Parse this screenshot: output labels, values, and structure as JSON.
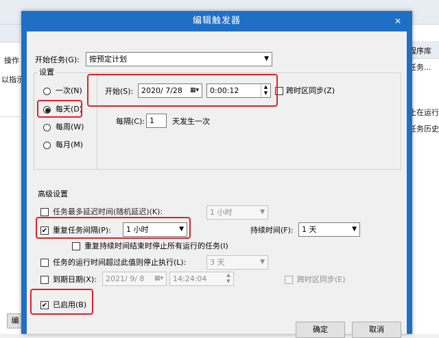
{
  "background": {
    "right_header": "程序库",
    "right_items": [
      "任务...",
      "止在运行",
      "任务历史"
    ],
    "left_items": [
      "操作",
      "以指示"
    ],
    "bottom_left_button": "编"
  },
  "dialog": {
    "title": "编辑触发器",
    "close_label": "✕",
    "begin_task_label": "开始任务(G):",
    "begin_task_value": "按预定计划",
    "settings_label": "设置",
    "schedule_options": [
      "一次(N)",
      "每天(D)",
      "每周(W)",
      "每月(M)"
    ],
    "selected_schedule": 1,
    "start_label": "开始(S):",
    "start_date": "2020/ 7/28",
    "start_time": "0:00:12",
    "sync_timezone_label": "跨时区同步(Z)",
    "recur_label": "每隔(C):",
    "recur_value": "1",
    "recur_unit": "天发生一次",
    "advanced_label": "高级设置",
    "delay_label": "任务最多延迟时间(随机延迟)(K):",
    "delay_value": "1 小时",
    "repeat_label": "重复任务间隔(P):",
    "repeat_value": "1 小时",
    "duration_label": "持续时间(F):",
    "duration_value": "1 天",
    "stop_at_end_label": "重复持续时间结束时停止所有运行的任务(I)",
    "stop_if_longer_label": "任务的运行时间超过此值则停止执行(L):",
    "stop_if_longer_value": "3 天",
    "expire_label": "到期日期(X):",
    "expire_date": "2021/ 9/ 8",
    "expire_time": "14:24:04",
    "expire_sync_label": "跨时区同步(E)",
    "enabled_label": "已启用(B)",
    "ok_label": "确定",
    "cancel_label": "取消"
  },
  "colors": {
    "titlebar": "#1f6fc5",
    "highlight": "#e0202a"
  }
}
